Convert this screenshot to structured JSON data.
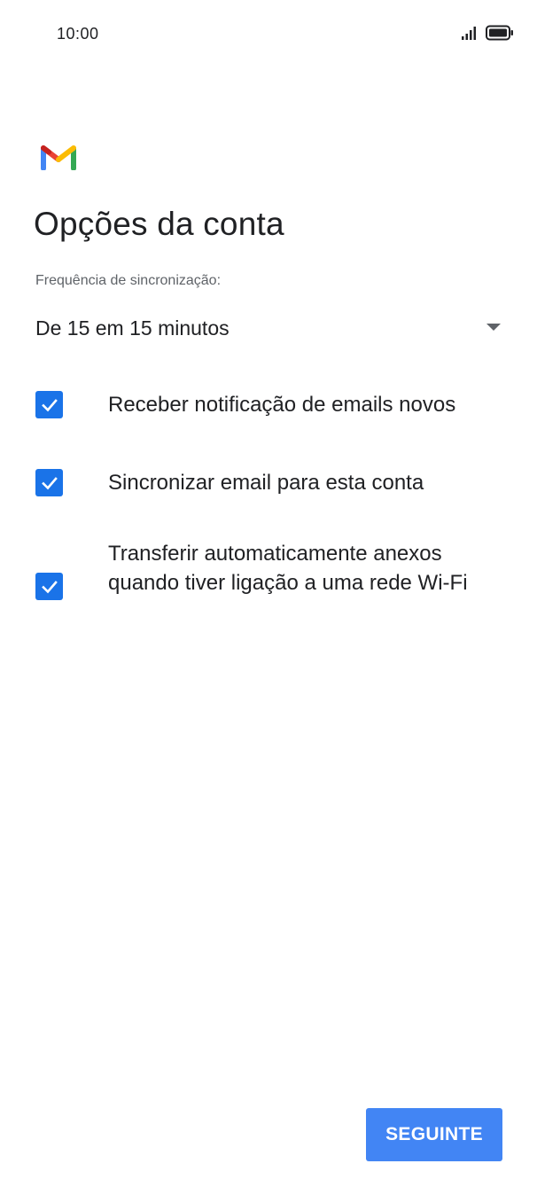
{
  "status_bar": {
    "time": "10:00",
    "icons": [
      "signal-icon",
      "battery-icon"
    ]
  },
  "app": {
    "logo": "gmail-logo",
    "brand_colors": [
      "#ea4335",
      "#fbbc04",
      "#34a853",
      "#4285f4",
      "#c5221f"
    ]
  },
  "page": {
    "title": "Opções da conta",
    "sync_frequency_label": "Frequência de sincronização:",
    "sync_frequency_value": "De 15 em 15 minutos"
  },
  "options": [
    {
      "label": "Receber notificação de emails novos",
      "checked": true
    },
    {
      "label": "Sincronizar email para esta conta",
      "checked": true
    },
    {
      "label": "Transferir automaticamente anexos quando tiver ligação a uma rede Wi-Fi",
      "checked": true
    }
  ],
  "actions": {
    "next_label": "SEGUINTE"
  },
  "colors": {
    "accent": "#1a73e8",
    "button": "#4285f4",
    "text": "#202124",
    "secondary_text": "#5f6368"
  }
}
